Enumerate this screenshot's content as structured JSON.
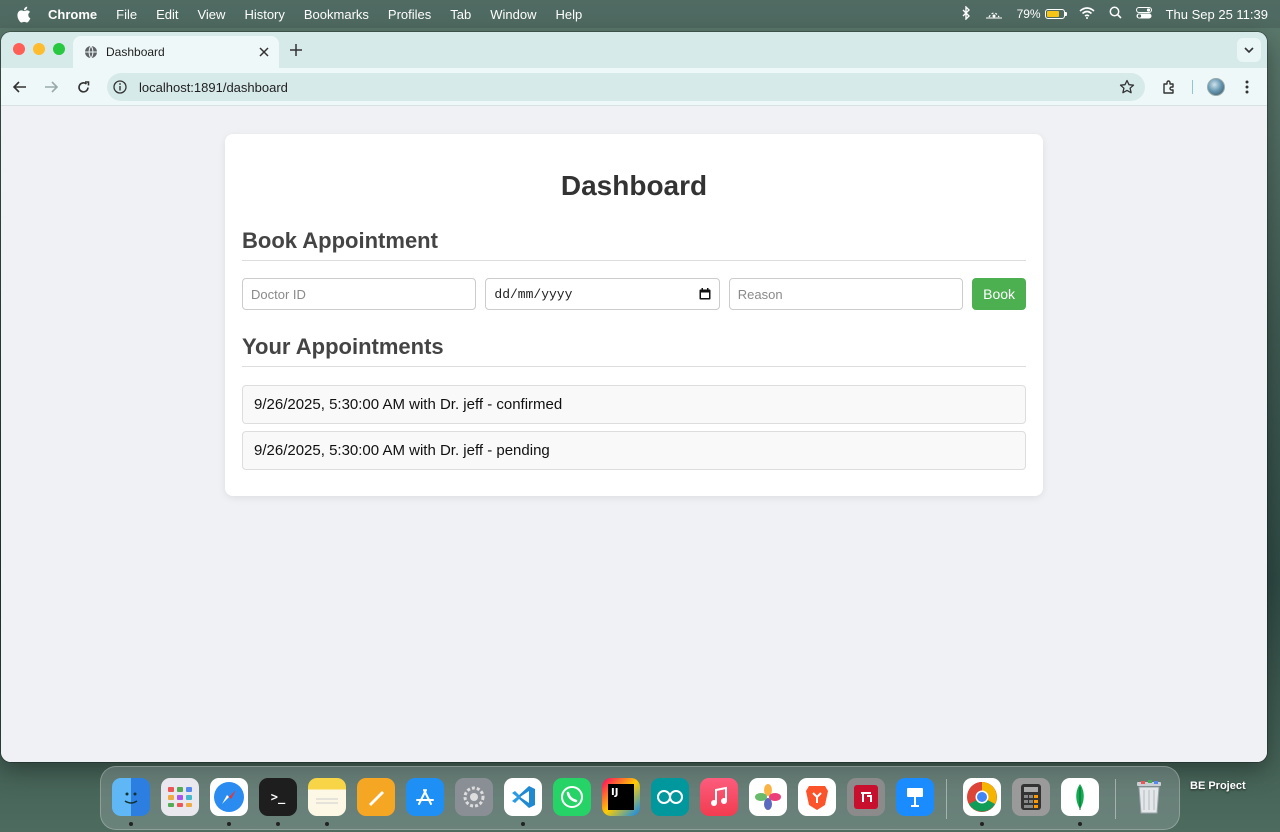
{
  "menubar": {
    "app_name": "Chrome",
    "items": [
      "File",
      "Edit",
      "View",
      "History",
      "Bookmarks",
      "Profiles",
      "Tab",
      "Window",
      "Help"
    ],
    "battery_percent": "79%",
    "clock": "Thu Sep 25  11:39"
  },
  "browser": {
    "tab_title": "Dashboard",
    "url": "localhost:1891/dashboard"
  },
  "page": {
    "title": "Dashboard",
    "book_section_title": "Book Appointment",
    "doctor_id_placeholder": "Doctor ID",
    "date_placeholder": "dd/mm/yyyy",
    "reason_placeholder": "Reason",
    "book_button": "Book",
    "appointments_section_title": "Your Appointments",
    "appointments": [
      "9/26/2025, 5:30:00 AM with Dr. jeff - confirmed",
      "9/26/2025, 5:30:00 AM with Dr. jeff - pending"
    ]
  },
  "dock": {
    "apps": [
      "finder",
      "launchpad",
      "safari",
      "terminal",
      "notes",
      "pages",
      "app-store",
      "system-settings",
      "vscode",
      "whatsapp",
      "intellij",
      "arduino",
      "music",
      "photos",
      "brave",
      "foxit",
      "keynote",
      "chrome",
      "calculator",
      "mongodb-compass",
      "trash"
    ],
    "desktop_label": "BE Project"
  },
  "colors": {
    "book_button": "#4caf50",
    "page_bg": "#eff1f5",
    "tabstrip_bg": "#d7eaea"
  }
}
